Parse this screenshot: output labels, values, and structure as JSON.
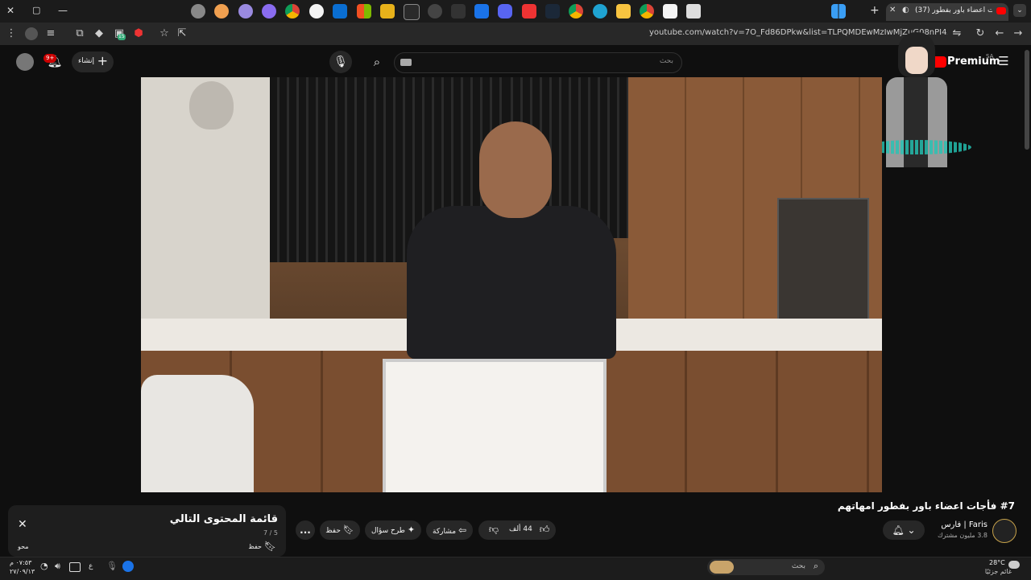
{
  "browser": {
    "tab_title": "(37) فأجات اعضاء باور بفطور",
    "url": "youtube.com/watch?v=7O_Fd86DPkw&list=TLPQMDEwMzIwMjZuG08nPI4A...dex=5",
    "extensions_badge": "15"
  },
  "header": {
    "logo_text": "Premium",
    "region": "SA",
    "search_placeholder": "بحث",
    "create_label": "إنشاء",
    "notifications_badge": "9+"
  },
  "video": {
    "title": "#7 فأجات اعضاء باور بفطور امهاتهم"
  },
  "channel": {
    "name": "فارس | Faris",
    "subscribers": "3.8 مليون مشترك"
  },
  "actions": {
    "likes": "44 ألف",
    "share": "مشاركة",
    "ask": "طرح سؤال",
    "save": "حفظ",
    "more": "..."
  },
  "playlist": {
    "title": "قائمة المحتوى التالي",
    "position": "7 / 5",
    "save_label": "حفظ",
    "shuffle_label": "محو"
  },
  "taskbar": {
    "search_placeholder": "بحث",
    "weather_temp": "28°C",
    "weather_text": "غائم جزئيًا",
    "time": "٠٧:٥٣ م",
    "date": "٢٧/٠٩/١٣",
    "lang": "ع"
  },
  "colors": {
    "yt_red": "#ff0000",
    "bg": "#0f0f0f"
  }
}
